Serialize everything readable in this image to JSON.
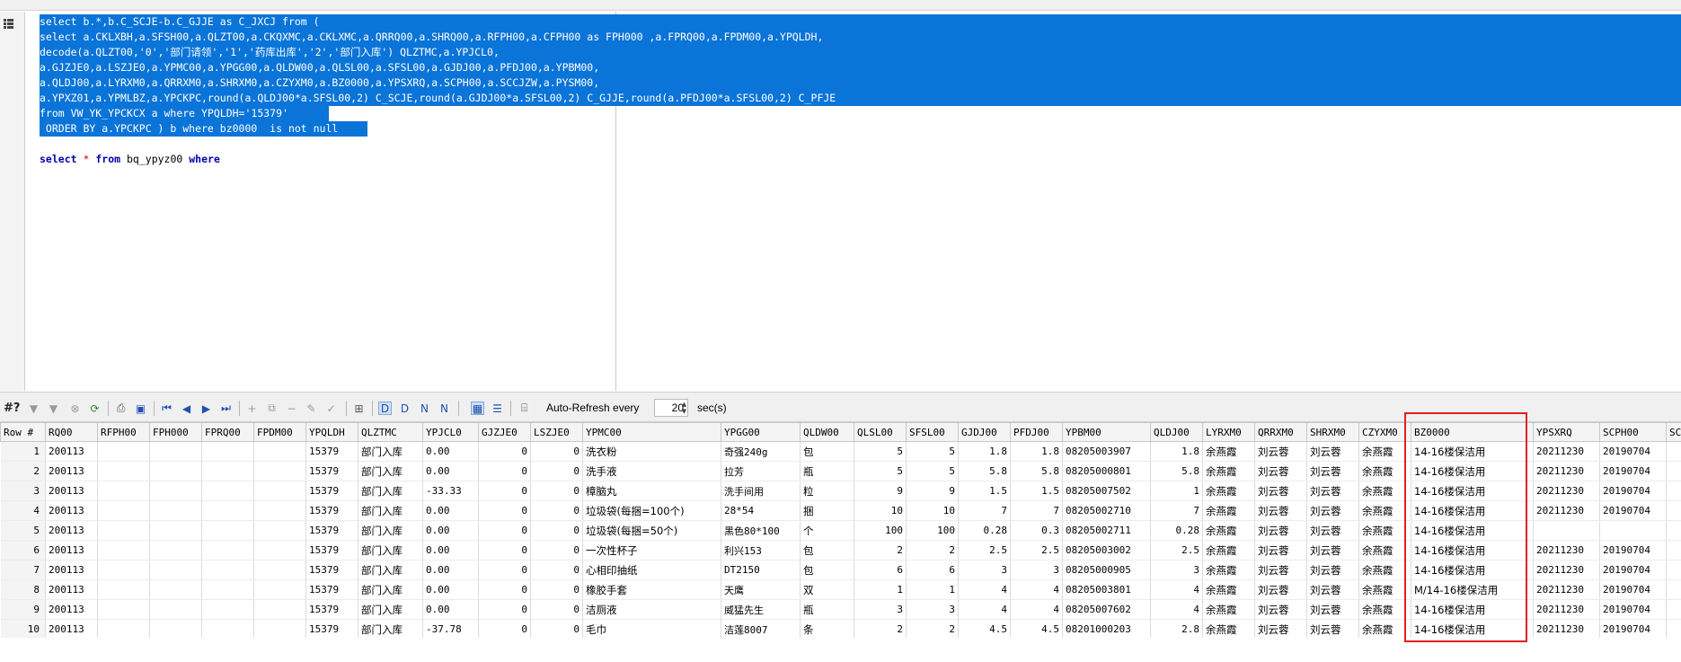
{
  "editor": {
    "selected_lines": [
      "select b.*,b.C_SCJE-b.C_GJJE as C_JXCJ from (",
      "select a.CKLXBH,a.SFSH00,a.QLZT00,a.CKQXMC,a.CKLXMC,a.QRRQ00,a.SHRQ00,a.RFPH00,a.CFPH00 as FPH000 ,a.FPRQ00,a.FPDM00,a.YPQLDH,",
      "decode(a.QLZT00,'0','部门请领','1','药库出库','2','部门入库') QLZTMC,a.YPJCL0,",
      "a.GJZJE0,a.LSZJE0,a.YPMC00,a.YPGG00,a.QLDW00,a.QLSL00,a.SFSL00,a.GJDJ00,a.PFDJ00,a.YPBM00,",
      "a.QLDJ00,a.LYRXM0,a.QRRXM0,a.SHRXM0,a.CZYXM0,a.BZ0000,a.YPSXRQ,a.SCPH00,a.SCCJZW,a.PYSM00,",
      "a.YPXZ01,a.YPMLBZ,a.YPCKPC,round(a.QLDJ00*a.SFSL00,2) C_SCJE,round(a.GJDJ00*a.SFSL00,2) C_GJJE,round(a.PFDJ00*a.SFSL00,2) C_PFJE",
      "from VW_YK_YPCKCX a where YPQLDH='15379'",
      " ORDER BY a.YPCKPC ) b where bz0000  is not null"
    ],
    "query_line": {
      "kw1": "select",
      "star": "*",
      "kw2": "from",
      "table": "bq_ypyz00",
      "kw3": "where"
    }
  },
  "grid_toolbar": {
    "row_marker": "#?",
    "auto_refresh_label": "Auto-Refresh every",
    "refresh_value": "20",
    "sec_label": "sec(s)"
  },
  "grid": {
    "columns": [
      "Row #",
      "RQ00",
      "RFPH00",
      "FPH000",
      "FPRQ00",
      "FPDM00",
      "YPQLDH",
      "QLZTMC",
      "YPJCL0",
      "GJZJE0",
      "LSZJE0",
      "YPMC00",
      "YPGG00",
      "QLDW00",
      "QLSL00",
      "SFSL00",
      "GJDJ00",
      "PFDJ00",
      "YPBM00",
      "QLDJ00",
      "LYRXM0",
      "QRRXM0",
      "SHRXM0",
      "CZYXM0",
      "BZ0000",
      "YPSXRQ",
      "SCPH00",
      "SCC"
    ],
    "rows": [
      [
        "1",
        "200113",
        "",
        "",
        "",
        "",
        "15379",
        "部门入库",
        "0.00",
        "0",
        "0",
        "洗衣粉",
        "奇强240g",
        "包",
        "5",
        "5",
        "1.8",
        "1.8",
        "08205003907",
        "1.8",
        "余燕霞",
        "刘云蓉",
        "刘云蓉",
        "余燕霞",
        "14-16楼保洁用",
        "20211230",
        "20190704",
        ""
      ],
      [
        "2",
        "200113",
        "",
        "",
        "",
        "",
        "15379",
        "部门入库",
        "0.00",
        "0",
        "0",
        "洗手液",
        "拉芳",
        "瓶",
        "5",
        "5",
        "5.8",
        "5.8",
        "08205000801",
        "5.8",
        "余燕霞",
        "刘云蓉",
        "刘云蓉",
        "余燕霞",
        "14-16楼保洁用",
        "20211230",
        "20190704",
        ""
      ],
      [
        "3",
        "200113",
        "",
        "",
        "",
        "",
        "15379",
        "部门入库",
        "-33.33",
        "0",
        "0",
        "樟脑丸",
        "洗手间用",
        "粒",
        "9",
        "9",
        "1.5",
        "1.5",
        "08205007502",
        "1",
        "余燕霞",
        "刘云蓉",
        "刘云蓉",
        "余燕霞",
        "14-16楼保洁用",
        "20211230",
        "20190704",
        ""
      ],
      [
        "4",
        "200113",
        "",
        "",
        "",
        "",
        "15379",
        "部门入库",
        "0.00",
        "0",
        "0",
        "垃圾袋(每捆=100个)",
        "28*54",
        "捆",
        "10",
        "10",
        "7",
        "7",
        "08205002710",
        "7",
        "余燕霞",
        "刘云蓉",
        "刘云蓉",
        "余燕霞",
        "14-16楼保洁用",
        "20211230",
        "20190704",
        ""
      ],
      [
        "5",
        "200113",
        "",
        "",
        "",
        "",
        "15379",
        "部门入库",
        "0.00",
        "0",
        "0",
        "垃圾袋(每捆=50个)",
        "黑色80*100",
        "个",
        "100",
        "100",
        "0.28",
        "0.3",
        "08205002711",
        "0.28",
        "余燕霞",
        "刘云蓉",
        "刘云蓉",
        "余燕霞",
        "14-16楼保洁用",
        "",
        "",
        ""
      ],
      [
        "6",
        "200113",
        "",
        "",
        "",
        "",
        "15379",
        "部门入库",
        "0.00",
        "0",
        "0",
        "一次性杯子",
        "利兴153",
        "包",
        "2",
        "2",
        "2.5",
        "2.5",
        "08205003002",
        "2.5",
        "余燕霞",
        "刘云蓉",
        "刘云蓉",
        "余燕霞",
        "14-16楼保洁用",
        "20211230",
        "20190704",
        ""
      ],
      [
        "7",
        "200113",
        "",
        "",
        "",
        "",
        "15379",
        "部门入库",
        "0.00",
        "0",
        "0",
        "心相印抽纸",
        "DT2150",
        "包",
        "6",
        "6",
        "3",
        "3",
        "08205000905",
        "3",
        "余燕霞",
        "刘云蓉",
        "刘云蓉",
        "余燕霞",
        "14-16楼保洁用",
        "20211230",
        "20190704",
        ""
      ],
      [
        "8",
        "200113",
        "",
        "",
        "",
        "",
        "15379",
        "部门入库",
        "0.00",
        "0",
        "0",
        "橡胶手套",
        "天鹰",
        "双",
        "1",
        "1",
        "4",
        "4",
        "08205003801",
        "4",
        "余燕霞",
        "刘云蓉",
        "刘云蓉",
        "余燕霞",
        "M/14-16楼保洁用",
        "20211230",
        "20190704",
        ""
      ],
      [
        "9",
        "200113",
        "",
        "",
        "",
        "",
        "15379",
        "部门入库",
        "0.00",
        "0",
        "0",
        "洁厕液",
        "威猛先生",
        "瓶",
        "3",
        "3",
        "4",
        "4",
        "08205007602",
        "4",
        "余燕霞",
        "刘云蓉",
        "刘云蓉",
        "余燕霞",
        "14-16楼保洁用",
        "20211230",
        "20190704",
        ""
      ],
      [
        "10",
        "200113",
        "",
        "",
        "",
        "",
        "15379",
        "部门入库",
        "-37.78",
        "0",
        "0",
        "毛巾",
        "洁莲8007",
        "条",
        "2",
        "2",
        "4.5",
        "4.5",
        "08201000203",
        "2.8",
        "余燕霞",
        "刘云蓉",
        "刘云蓉",
        "余燕霞",
        "14-16楼保洁用",
        "20211230",
        "20190704",
        ""
      ]
    ]
  },
  "colors": {
    "selection": "#0a74d8",
    "annotation": "#e02020"
  }
}
